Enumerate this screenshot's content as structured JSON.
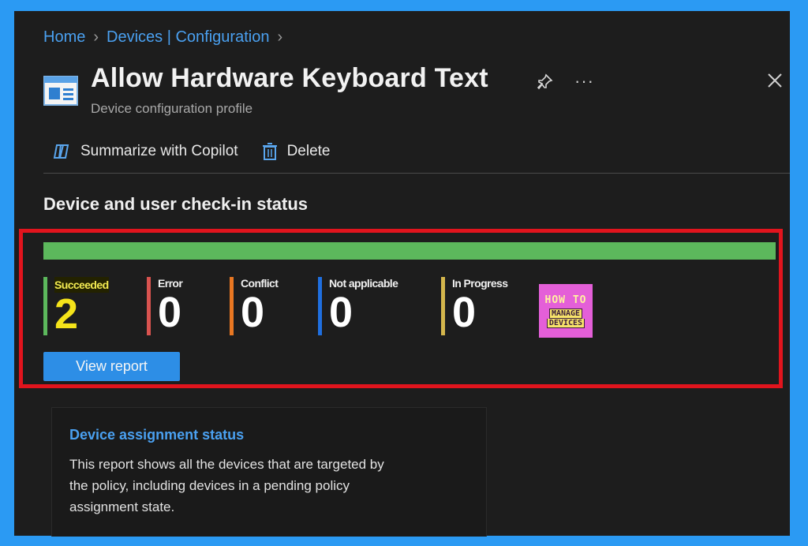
{
  "breadcrumb": {
    "items": [
      "Home",
      "Devices | Configuration"
    ]
  },
  "header": {
    "title": "Allow Hardware Keyboard Text",
    "subtitle": "Device configuration profile",
    "more": "···"
  },
  "toolbar": {
    "copilot_label": "Summarize with Copilot",
    "delete_label": "Delete"
  },
  "checkin": {
    "title": "Device and user check-in status",
    "progress_succeeded_fraction": 1.0,
    "stats": [
      {
        "label": "Succeeded",
        "value": "2",
        "color": "#5cb85c"
      },
      {
        "label": "Error",
        "value": "0",
        "color": "#d9534f"
      },
      {
        "label": "Conflict",
        "value": "0",
        "color": "#e87722"
      },
      {
        "label": "Not applicable",
        "value": "0",
        "color": "#1f6fe0"
      },
      {
        "label": "In Progress",
        "value": "0",
        "color": "#d4b64c"
      }
    ],
    "view_report_label": "View report"
  },
  "logo": {
    "line1": "HOW TO",
    "line2": "MANAGE",
    "line3": "DEVICES"
  },
  "assignment_card": {
    "title": "Device assignment status",
    "description": "This report shows all the devices that are targeted by the policy, including devices in a pending policy assignment state."
  },
  "colors": {
    "accent": "#4aa0f0",
    "highlight_border": "#e1141d",
    "page_border": "#2b9af3"
  }
}
